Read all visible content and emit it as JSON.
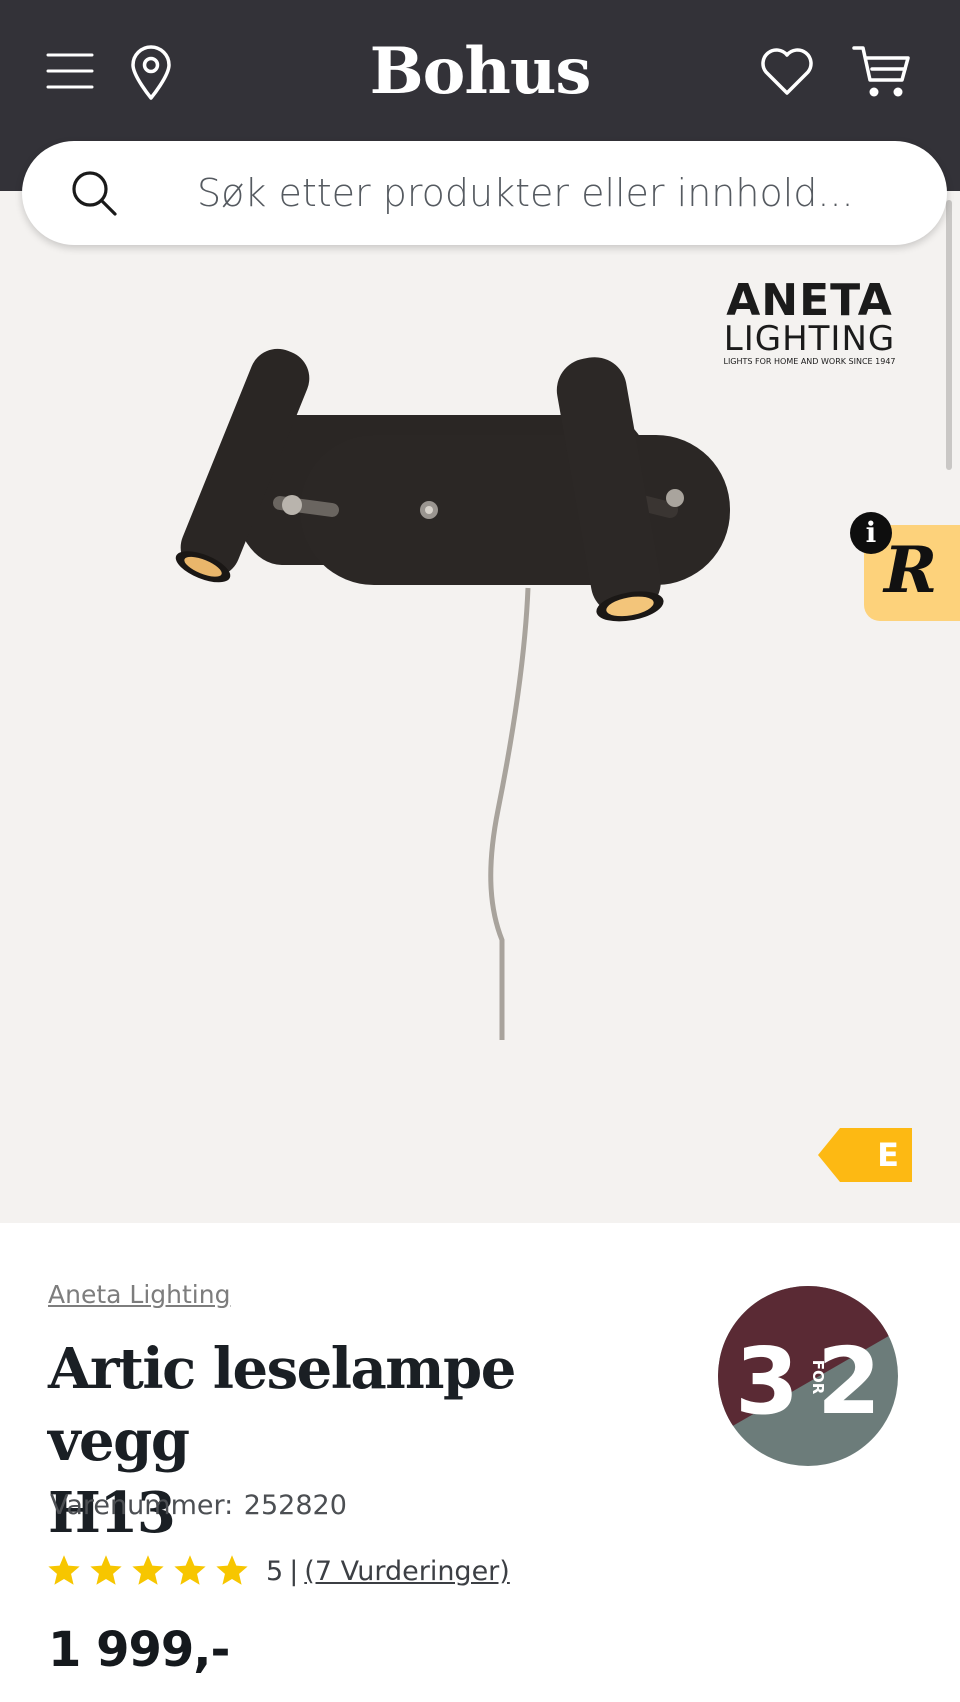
{
  "header": {
    "logo": "Bohus",
    "menu_icon": "hamburger-menu-icon",
    "location_icon": "map-pin-icon",
    "wishlist_icon": "heart-icon",
    "cart_icon": "cart-icon",
    "background": "#333238"
  },
  "search": {
    "placeholder": "Søk etter produkter eller innhold..."
  },
  "gallery": {
    "brand_logo_line1": "ANETA",
    "brand_logo_line2": "LIGHTING",
    "brand_logo_tagline": "LIGHTS FOR HOME AND WORK SINCE 1947",
    "energy_class": "E",
    "energy_color": "#fdb913",
    "widget_letter": "R",
    "widget_info": "i",
    "background": "#f4f2f0"
  },
  "product": {
    "brand": "Aneta Lighting",
    "title_line1": "Artic leselampe vegg",
    "title_line2": "H13",
    "sku_label": "Varenummer:",
    "sku_value": "252820",
    "rating_value": "5",
    "rating_max": 5,
    "separator": "|",
    "reviews_text": "(7 Vurderinger)",
    "price": "1 999,-",
    "star_color": "#f7c600"
  },
  "promo_badge": {
    "left": "3",
    "middle": "FOR",
    "right": "2",
    "color_top": "#5a2a34",
    "color_bottom": "#6c7c7a"
  }
}
